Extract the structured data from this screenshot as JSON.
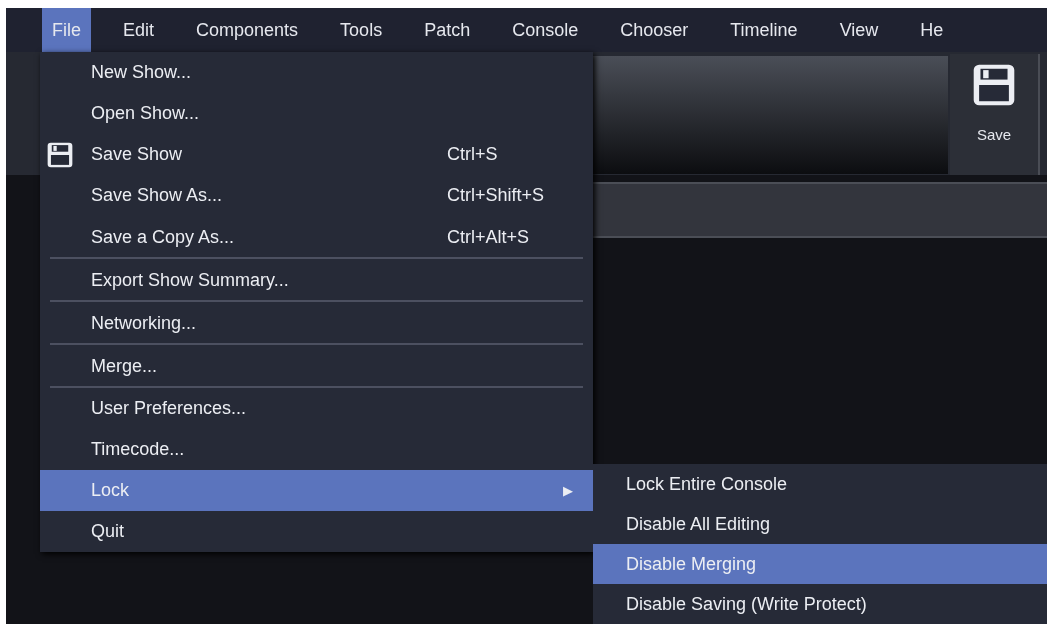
{
  "menubar": [
    {
      "label": "File",
      "selected": true
    },
    {
      "label": "Edit",
      "selected": false
    },
    {
      "label": "Components",
      "selected": false
    },
    {
      "label": "Tools",
      "selected": false
    },
    {
      "label": "Patch",
      "selected": false
    },
    {
      "label": "Console",
      "selected": false
    },
    {
      "label": "Chooser",
      "selected": false
    },
    {
      "label": "Timeline",
      "selected": false
    },
    {
      "label": "View",
      "selected": false
    },
    {
      "label": "He",
      "selected": false
    }
  ],
  "toolbar": {
    "save_button": {
      "label": "Save"
    }
  },
  "file_menu": [
    {
      "kind": "item",
      "label": "New Show...",
      "selected": false
    },
    {
      "kind": "item",
      "label": "Open Show...",
      "selected": false
    },
    {
      "kind": "icon_item",
      "label": "Save Show",
      "shortcut": "Ctrl+S",
      "selected": false
    },
    {
      "kind": "item",
      "label": "Save Show As...",
      "shortcut": "Ctrl+Shift+S",
      "selected": false
    },
    {
      "kind": "item",
      "label": "Save a Copy As...",
      "shortcut": "Ctrl+Alt+S",
      "selected": false,
      "separator_after": true
    },
    {
      "kind": "item",
      "label": "Export Show Summary...",
      "selected": false,
      "separator_after": true
    },
    {
      "kind": "item",
      "label": "Networking...",
      "selected": false,
      "separator_after": true
    },
    {
      "kind": "item",
      "label": "Merge...",
      "selected": false,
      "separator_after": true
    },
    {
      "kind": "item",
      "label": "User Preferences...",
      "selected": false
    },
    {
      "kind": "item",
      "label": "Timecode...",
      "selected": false
    },
    {
      "kind": "submenu",
      "label": "Lock",
      "arrow": "▶",
      "selected": true
    },
    {
      "kind": "item",
      "label": "Quit",
      "selected": false
    }
  ],
  "lock_submenu": [
    {
      "label": "Lock Entire Console",
      "selected": false
    },
    {
      "label": "Disable All Editing",
      "selected": false
    },
    {
      "label": "Disable Merging",
      "selected": true
    },
    {
      "label": "Disable Saving (Write Protect)",
      "selected": false
    }
  ]
}
